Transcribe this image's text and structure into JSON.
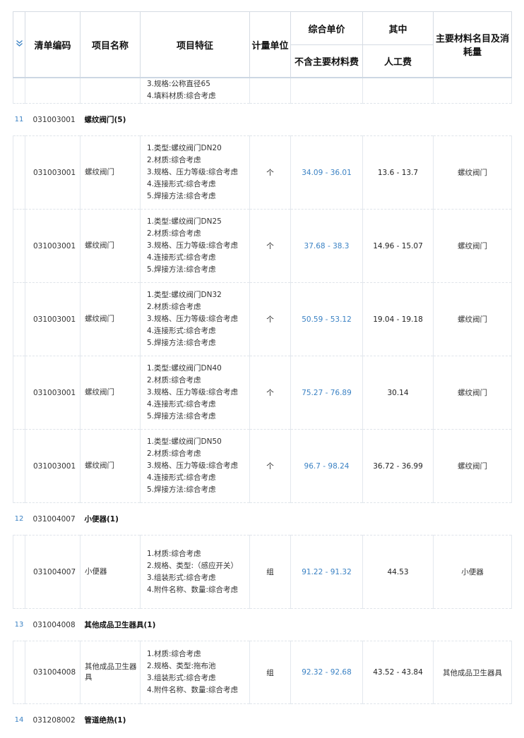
{
  "header": {
    "chevron_icon": "chevron-double-down-icon",
    "col_code": "清单编码",
    "col_name": "项目名称",
    "col_features": "项目特征",
    "col_unit": "计量单位",
    "col_unit_price": "综合单价",
    "col_unit_price_sub": "不含主要材料费",
    "col_among": "其中",
    "col_among_sub": "人工费",
    "col_materials": "主要材料名目及消耗量"
  },
  "continued_features": [
    "3.规格:公称直径65",
    "4.填料材质:综合考虑"
  ],
  "groups": [
    {
      "index": "11",
      "code": "031003001",
      "title": "螺纹阀门(5)",
      "rows": [
        {
          "code": "031003001",
          "name": "螺纹阀门",
          "features": [
            "1.类型:螺纹阀门DN20",
            "2.材质:综合考虑",
            "3.规格、压力等级:综合考虑",
            "4.连接形式:综合考虑",
            "5.焊接方法:综合考虑"
          ],
          "unit": "个",
          "price": "34.09 - 36.01",
          "labor": "13.6 - 13.7",
          "material": "螺纹阀门"
        },
        {
          "code": "031003001",
          "name": "螺纹阀门",
          "features": [
            "1.类型:螺纹阀门DN25",
            "2.材质:综合考虑",
            "3.规格、压力等级:综合考虑",
            "4.连接形式:综合考虑",
            "5.焊接方法:综合考虑"
          ],
          "unit": "个",
          "price": "37.68 - 38.3",
          "labor": "14.96 - 15.07",
          "material": "螺纹阀门"
        },
        {
          "code": "031003001",
          "name": "螺纹阀门",
          "features": [
            "1.类型:螺纹阀门DN32",
            "2.材质:综合考虑",
            "3.规格、压力等级:综合考虑",
            "4.连接形式:综合考虑",
            "5.焊接方法:综合考虑"
          ],
          "unit": "个",
          "price": "50.59 - 53.12",
          "labor": "19.04 - 19.18",
          "material": "螺纹阀门"
        },
        {
          "code": "031003001",
          "name": "螺纹阀门",
          "features": [
            "1.类型:螺纹阀门DN40",
            "2.材质:综合考虑",
            "3.规格、压力等级:综合考虑",
            "4.连接形式:综合考虑",
            "5.焊接方法:综合考虑"
          ],
          "unit": "个",
          "price": "75.27 - 76.89",
          "labor": "30.14",
          "material": "螺纹阀门"
        },
        {
          "code": "031003001",
          "name": "螺纹阀门",
          "features": [
            "1.类型:螺纹阀门DN50",
            "2.材质:综合考虑",
            "3.规格、压力等级:综合考虑",
            "4.连接形式:综合考虑",
            "5.焊接方法:综合考虑"
          ],
          "unit": "个",
          "price": "96.7 - 98.24",
          "labor": "36.72 - 36.99",
          "material": "螺纹阀门"
        }
      ]
    },
    {
      "index": "12",
      "code": "031004007",
      "title": "小便器(1)",
      "rows": [
        {
          "code": "031004007",
          "name": "小便器",
          "features": [
            "1.材质:综合考虑",
            "2.规格、类型:（感应开关）",
            "3.组装形式:综合考虑",
            "4.附件名称、数量:综合考虑"
          ],
          "unit": "组",
          "price": "91.22 - 91.32",
          "labor": "44.53",
          "material": "小便器"
        }
      ]
    },
    {
      "index": "13",
      "code": "031004008",
      "title": "其他成品卫生器具(1)",
      "rows": [
        {
          "code": "031004008",
          "name": "其他成品卫生器具",
          "features": [
            "1.材质:综合考虑",
            "2.规格、类型:拖布池",
            "3.组装形式:综合考虑",
            "4.附件名称、数量:综合考虑"
          ],
          "unit": "组",
          "price": "92.32 - 92.68",
          "labor": "43.52 - 43.84",
          "material": "其他成品卫生器具"
        }
      ]
    },
    {
      "index": "14",
      "code": "031208002",
      "title": "管道绝热(1)",
      "rows": []
    }
  ]
}
